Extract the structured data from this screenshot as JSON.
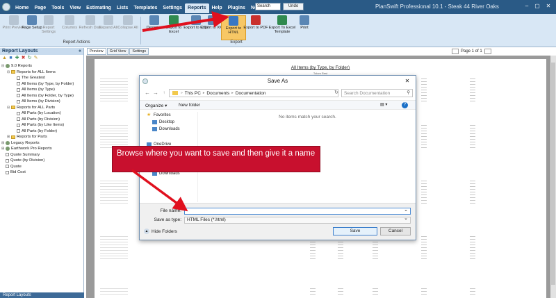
{
  "menu": [
    "Home",
    "Page",
    "Tools",
    "View",
    "Estimating",
    "Lists",
    "Templates",
    "Settings",
    "Reports",
    "Help",
    "Plugins",
    "Need Work?"
  ],
  "search_value": "Search",
  "undo_label": "Undo",
  "app_title": "PlanSwift Professional 10.1 - Steak 44 River Oaks",
  "window_controls": [
    "–",
    "▢",
    "✕"
  ],
  "ribbon": {
    "buttons": [
      {
        "label": "Print Preview"
      },
      {
        "label": "Page Setup"
      },
      {
        "label": "Report Settings"
      },
      {
        "label": "Columns"
      },
      {
        "label": "Refresh Data"
      },
      {
        "label": "Expand All"
      },
      {
        "label": "Collapse All"
      },
      {
        "label": "Designer"
      },
      {
        "label": "Export to Excel"
      },
      {
        "label": "Export to CSV"
      },
      {
        "label": "Export to XML"
      },
      {
        "label": "Export to HTML"
      },
      {
        "label": "Export to PDF"
      },
      {
        "label": "Export To Excel Template"
      },
      {
        "label": "Print"
      }
    ],
    "group_actions": "Report Actions",
    "group_export": "Export"
  },
  "left_panel": {
    "title": "Report Layouts",
    "collapse": "«",
    "tree": [
      {
        "label": "9.0 Reports",
        "level": 0,
        "type": "disk",
        "ex": "⊟"
      },
      {
        "label": "Reports for ALL Items",
        "level": 1,
        "type": "folder",
        "ex": "⊟"
      },
      {
        "label": "The Greatest",
        "level": 2,
        "type": "doc",
        "ex": ""
      },
      {
        "label": "All Items (by Type, by Folder)",
        "level": 2,
        "type": "doc",
        "ex": ""
      },
      {
        "label": "All Items (by Type)",
        "level": 2,
        "type": "doc",
        "ex": ""
      },
      {
        "label": "All Items (by Folder, by Type)",
        "level": 2,
        "type": "doc",
        "ex": ""
      },
      {
        "label": "All Items (by Division)",
        "level": 2,
        "type": "doc",
        "ex": ""
      },
      {
        "label": "Reports for ALL Parts",
        "level": 1,
        "type": "folder",
        "ex": "⊟"
      },
      {
        "label": "All Parts (by Location)",
        "level": 2,
        "type": "doc",
        "ex": ""
      },
      {
        "label": "All Parts (by Division)",
        "level": 2,
        "type": "doc",
        "ex": ""
      },
      {
        "label": "All Parts (by Like Items)",
        "level": 2,
        "type": "doc",
        "ex": ""
      },
      {
        "label": "All Parts (by Folder)",
        "level": 2,
        "type": "doc",
        "ex": ""
      },
      {
        "label": "Reports for Parts",
        "level": 1,
        "type": "folder",
        "ex": "⊞"
      },
      {
        "label": "Legacy Reports",
        "level": 0,
        "type": "disk",
        "ex": "⊞"
      },
      {
        "label": "Earthwork Pro Reports",
        "level": 0,
        "type": "disk",
        "ex": "⊞"
      },
      {
        "label": "Quote Summary",
        "level": 0,
        "type": "doc",
        "ex": ""
      },
      {
        "label": "Quote (by Division)",
        "level": 0,
        "type": "doc",
        "ex": ""
      },
      {
        "label": "Quote",
        "level": 0,
        "type": "doc",
        "ex": ""
      },
      {
        "label": "Bid Cost",
        "level": 0,
        "type": "doc",
        "ex": ""
      }
    ],
    "footer": "Report Layouts"
  },
  "viewer": {
    "tabs": [
      "Preview",
      "Grid View",
      "Settings"
    ],
    "page_label": "Page 1 of 1",
    "report_title": "All Items (by Type, by Folder)",
    "report_sub": "Tulum Rest"
  },
  "dialog": {
    "title": "Save As",
    "close": "✕",
    "path": [
      "This PC",
      "Documents",
      "Documentation"
    ],
    "search_placeholder": "Search Documentation",
    "organize": "Organize ▾",
    "new_folder": "New folder",
    "view_icon": "▤ ▾",
    "help": "?",
    "nav": [
      {
        "label": "Favorites",
        "icon": "star"
      },
      {
        "label": "Desktop",
        "icon": "desk"
      },
      {
        "label": "Downloads",
        "icon": "down"
      },
      {
        "label": "OneDrive",
        "icon": "cloud"
      },
      {
        "label": "This PC",
        "icon": "pc"
      },
      {
        "label": "Documents",
        "icon": "docs"
      },
      {
        "label": "Downloads",
        "icon": "down"
      }
    ],
    "empty_msg": "No items match your search.",
    "file_name_label": "File name:",
    "file_name_value": "",
    "save_type_label": "Save as type:",
    "save_type_value": "HTML Files (*.html)",
    "hide_folders": "Hide Folders",
    "save": "Save",
    "cancel": "Cancel"
  },
  "annotation": "Browse where you want to save and then give it a name",
  "colors": {
    "title_bar": "#2a5a86",
    "ribbon": "#d8e7f5",
    "highlight": "#f7c765",
    "annotation": "#c8102e",
    "arrow": "#e0101e"
  }
}
